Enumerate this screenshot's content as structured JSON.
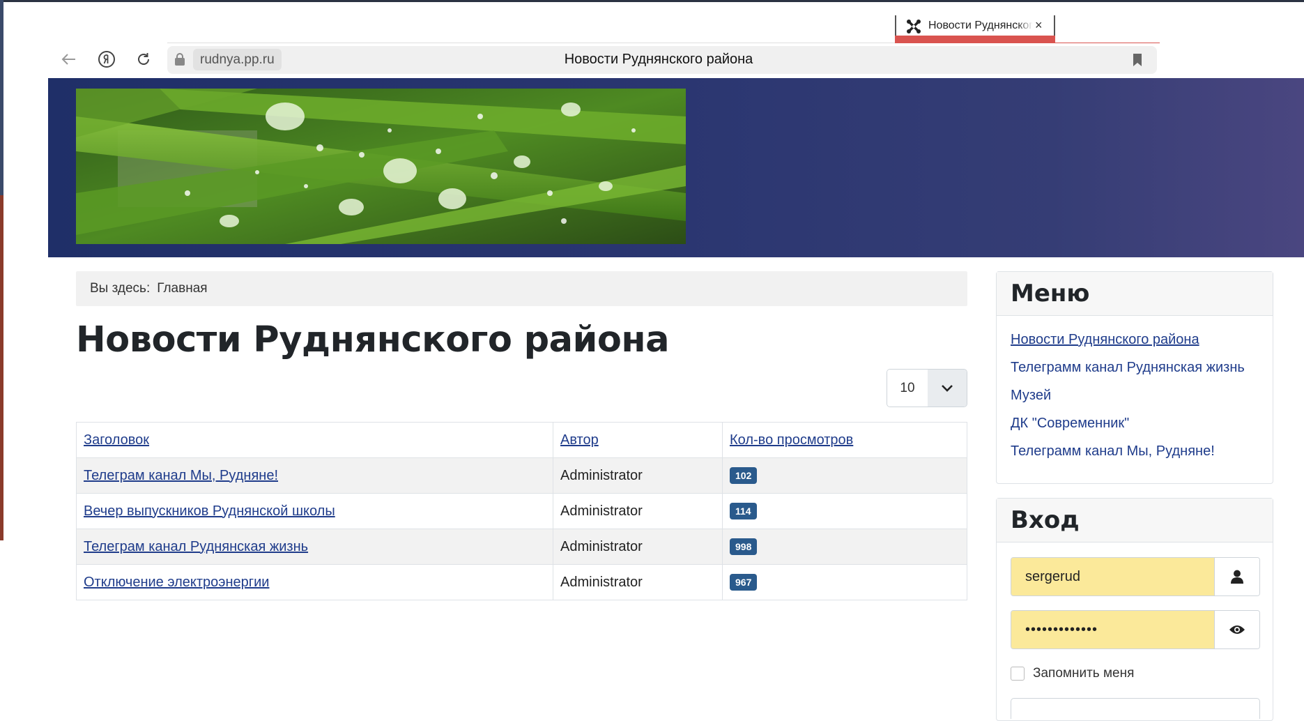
{
  "browser": {
    "tab_title": "Новости Руднянского района",
    "tab_close": "×",
    "domain": "rudnya.pp.ru",
    "page_title": "Новости Руднянского района"
  },
  "breadcrumb": {
    "label": "Вы здесь:",
    "current": "Главная"
  },
  "main": {
    "heading": "Новости Руднянского района",
    "limit_value": "10",
    "columns": [
      "Заголовок",
      "Автор",
      "Кол-во просмотров"
    ],
    "rows": [
      {
        "title": "Телеграм канал Мы, Рудняне!",
        "author": "Administrator",
        "views": "102"
      },
      {
        "title": "Вечер выпускников Руднянской школы",
        "author": "Administrator",
        "views": "114"
      },
      {
        "title": "Телеграм канал Руднянская жизнь",
        "author": "Administrator",
        "views": "998"
      },
      {
        "title": "Отключение электроэнергии",
        "author": "Administrator",
        "views": "967"
      }
    ]
  },
  "sidebar": {
    "menu_title": "Меню",
    "menu_items": [
      "Новости Руднянского района",
      "Телеграмм канал Руднянская жизнь",
      "Музей",
      "ДК \"Современник\"",
      "Телеграмм канал Мы, Рудняне!"
    ],
    "login_title": "Вход",
    "username_value": "sergerud",
    "password_value": "•••••••••••••",
    "remember_label": "Запомнить меня"
  },
  "colors": {
    "banner_start": "#1f2f68",
    "banner_end": "#4a4680",
    "link": "#1f3c8b",
    "badge": "#2a5a8c",
    "autofill": "#fbe99a",
    "tab_accent": "#d9534f"
  }
}
